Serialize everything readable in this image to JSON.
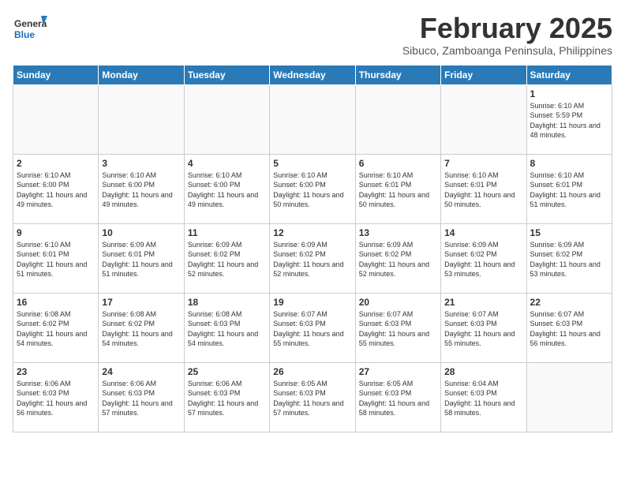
{
  "header": {
    "logo_general": "General",
    "logo_blue": "Blue",
    "month": "February 2025",
    "subtitle": "Sibuco, Zamboanga Peninsula, Philippines"
  },
  "weekdays": [
    "Sunday",
    "Monday",
    "Tuesday",
    "Wednesday",
    "Thursday",
    "Friday",
    "Saturday"
  ],
  "weeks": [
    [
      {
        "day": "",
        "info": ""
      },
      {
        "day": "",
        "info": ""
      },
      {
        "day": "",
        "info": ""
      },
      {
        "day": "",
        "info": ""
      },
      {
        "day": "",
        "info": ""
      },
      {
        "day": "",
        "info": ""
      },
      {
        "day": "1",
        "info": "Sunrise: 6:10 AM\nSunset: 5:59 PM\nDaylight: 11 hours and 48 minutes."
      }
    ],
    [
      {
        "day": "2",
        "info": "Sunrise: 6:10 AM\nSunset: 6:00 PM\nDaylight: 11 hours and 49 minutes."
      },
      {
        "day": "3",
        "info": "Sunrise: 6:10 AM\nSunset: 6:00 PM\nDaylight: 11 hours and 49 minutes."
      },
      {
        "day": "4",
        "info": "Sunrise: 6:10 AM\nSunset: 6:00 PM\nDaylight: 11 hours and 49 minutes."
      },
      {
        "day": "5",
        "info": "Sunrise: 6:10 AM\nSunset: 6:00 PM\nDaylight: 11 hours and 50 minutes."
      },
      {
        "day": "6",
        "info": "Sunrise: 6:10 AM\nSunset: 6:01 PM\nDaylight: 11 hours and 50 minutes."
      },
      {
        "day": "7",
        "info": "Sunrise: 6:10 AM\nSunset: 6:01 PM\nDaylight: 11 hours and 50 minutes."
      },
      {
        "day": "8",
        "info": "Sunrise: 6:10 AM\nSunset: 6:01 PM\nDaylight: 11 hours and 51 minutes."
      }
    ],
    [
      {
        "day": "9",
        "info": "Sunrise: 6:10 AM\nSunset: 6:01 PM\nDaylight: 11 hours and 51 minutes."
      },
      {
        "day": "10",
        "info": "Sunrise: 6:09 AM\nSunset: 6:01 PM\nDaylight: 11 hours and 51 minutes."
      },
      {
        "day": "11",
        "info": "Sunrise: 6:09 AM\nSunset: 6:02 PM\nDaylight: 11 hours and 52 minutes."
      },
      {
        "day": "12",
        "info": "Sunrise: 6:09 AM\nSunset: 6:02 PM\nDaylight: 11 hours and 52 minutes."
      },
      {
        "day": "13",
        "info": "Sunrise: 6:09 AM\nSunset: 6:02 PM\nDaylight: 11 hours and 52 minutes."
      },
      {
        "day": "14",
        "info": "Sunrise: 6:09 AM\nSunset: 6:02 PM\nDaylight: 11 hours and 53 minutes."
      },
      {
        "day": "15",
        "info": "Sunrise: 6:09 AM\nSunset: 6:02 PM\nDaylight: 11 hours and 53 minutes."
      }
    ],
    [
      {
        "day": "16",
        "info": "Sunrise: 6:08 AM\nSunset: 6:02 PM\nDaylight: 11 hours and 54 minutes."
      },
      {
        "day": "17",
        "info": "Sunrise: 6:08 AM\nSunset: 6:02 PM\nDaylight: 11 hours and 54 minutes."
      },
      {
        "day": "18",
        "info": "Sunrise: 6:08 AM\nSunset: 6:03 PM\nDaylight: 11 hours and 54 minutes."
      },
      {
        "day": "19",
        "info": "Sunrise: 6:07 AM\nSunset: 6:03 PM\nDaylight: 11 hours and 55 minutes."
      },
      {
        "day": "20",
        "info": "Sunrise: 6:07 AM\nSunset: 6:03 PM\nDaylight: 11 hours and 55 minutes."
      },
      {
        "day": "21",
        "info": "Sunrise: 6:07 AM\nSunset: 6:03 PM\nDaylight: 11 hours and 55 minutes."
      },
      {
        "day": "22",
        "info": "Sunrise: 6:07 AM\nSunset: 6:03 PM\nDaylight: 11 hours and 56 minutes."
      }
    ],
    [
      {
        "day": "23",
        "info": "Sunrise: 6:06 AM\nSunset: 6:03 PM\nDaylight: 11 hours and 56 minutes."
      },
      {
        "day": "24",
        "info": "Sunrise: 6:06 AM\nSunset: 6:03 PM\nDaylight: 11 hours and 57 minutes."
      },
      {
        "day": "25",
        "info": "Sunrise: 6:06 AM\nSunset: 6:03 PM\nDaylight: 11 hours and 57 minutes."
      },
      {
        "day": "26",
        "info": "Sunrise: 6:05 AM\nSunset: 6:03 PM\nDaylight: 11 hours and 57 minutes."
      },
      {
        "day": "27",
        "info": "Sunrise: 6:05 AM\nSunset: 6:03 PM\nDaylight: 11 hours and 58 minutes."
      },
      {
        "day": "28",
        "info": "Sunrise: 6:04 AM\nSunset: 6:03 PM\nDaylight: 11 hours and 58 minutes."
      },
      {
        "day": "",
        "info": ""
      }
    ]
  ]
}
